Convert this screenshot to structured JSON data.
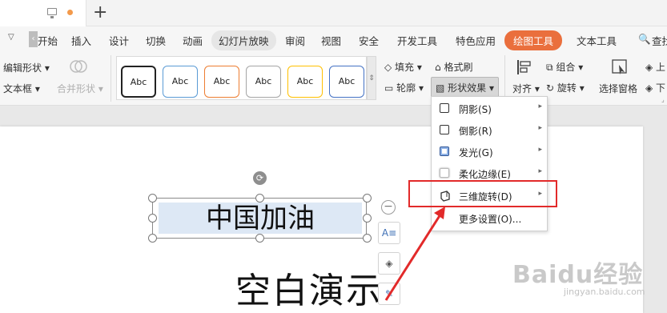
{
  "titlebar": {
    "new_tab": "+"
  },
  "ribbon_tabs": [
    "开始",
    "插入",
    "设计",
    "切换",
    "动画",
    "幻灯片放映",
    "审阅",
    "视图",
    "安全",
    "开发工具",
    "特色应用",
    "绘图工具",
    "文本工具",
    "查找"
  ],
  "active_tab": "绘图工具",
  "toolbar": {
    "edit_shape": "编辑形状",
    "text_box": "文本框",
    "merge_shape": "合并形状",
    "style_samples": [
      "Abc",
      "Abc",
      "Abc",
      "Abc",
      "Abc",
      "Abc"
    ],
    "fill": "填充",
    "format_painter": "格式刷",
    "outline": "轮廓",
    "shape_effect": "形状效果",
    "align": "对齐",
    "group": "组合",
    "rotate": "旋转",
    "select_pane": "选择窗格",
    "up": "上",
    "down": "下"
  },
  "slide": {
    "title": "中国加油",
    "subtitle": "空白演示"
  },
  "side_tools": {
    "text_icon": "A"
  },
  "effect_menu": {
    "items": [
      {
        "label": "阴影(S)",
        "has_submenu": true
      },
      {
        "label": "倒影(R)",
        "has_submenu": true
      },
      {
        "label": "发光(G)",
        "has_submenu": true
      },
      {
        "label": "柔化边缘(E)",
        "has_submenu": true
      },
      {
        "label": "三维旋转(D)",
        "has_submenu": true
      },
      {
        "label": "更多设置(O)...",
        "has_submenu": false
      }
    ]
  },
  "watermark": {
    "brand": "Baidu经验",
    "url": "jingyan.baidu.com"
  },
  "colors": {
    "accent": "#ea6f3d",
    "highlight": "#e22a2a"
  }
}
